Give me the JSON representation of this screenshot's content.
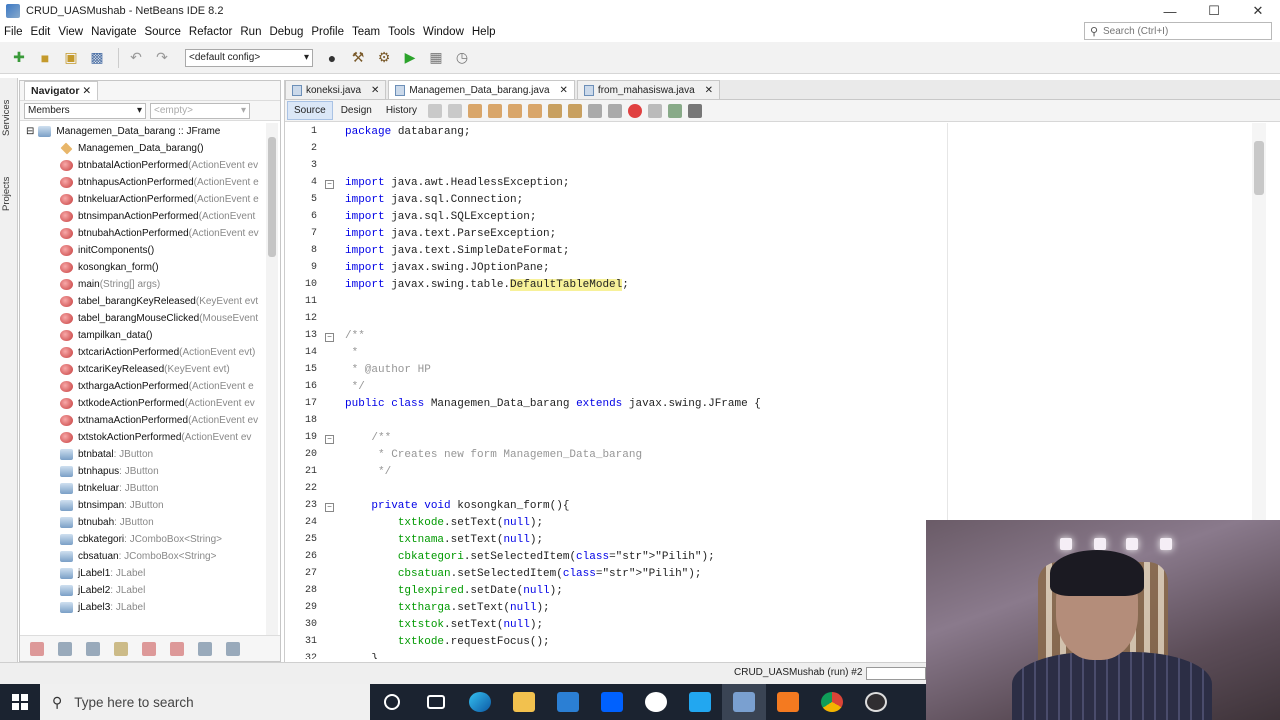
{
  "window": {
    "title": "CRUD_UASMushab - NetBeans IDE 8.2",
    "controls": [
      "—",
      "☐",
      "✕"
    ]
  },
  "menu": [
    "File",
    "Edit",
    "View",
    "Navigate",
    "Source",
    "Refactor",
    "Run",
    "Debug",
    "Profile",
    "Team",
    "Tools",
    "Window",
    "Help"
  ],
  "search": {
    "placeholder": "Search (Ctrl+I)"
  },
  "toolbar": {
    "config": "<default config>"
  },
  "side_tabs": [
    "Services",
    "Projects"
  ],
  "navigator": {
    "title": "Navigator",
    "filter": "Members",
    "empty": "<empty>",
    "root": "Managemen_Data_barang :: JFrame",
    "items": [
      {
        "name": "Managemen_Data_barang()",
        "sig": "",
        "kind": "ctor"
      },
      {
        "name": "btnbatalActionPerformed",
        "sig": "(ActionEvent ev",
        "kind": "m"
      },
      {
        "name": "btnhapusActionPerformed",
        "sig": "(ActionEvent e",
        "kind": "m"
      },
      {
        "name": "btnkeluarActionPerformed",
        "sig": "(ActionEvent e",
        "kind": "m"
      },
      {
        "name": "btnsimpanActionPerformed",
        "sig": "(ActionEvent",
        "kind": "m"
      },
      {
        "name": "btnubahActionPerformed",
        "sig": "(ActionEvent ev",
        "kind": "m"
      },
      {
        "name": "initComponents()",
        "sig": "",
        "kind": "m"
      },
      {
        "name": "kosongkan_form()",
        "sig": "",
        "kind": "m"
      },
      {
        "name": "main",
        "sig": "(String[] args)",
        "kind": "m"
      },
      {
        "name": "tabel_barangKeyReleased",
        "sig": "(KeyEvent evt",
        "kind": "m"
      },
      {
        "name": "tabel_barangMouseClicked",
        "sig": "(MouseEvent",
        "kind": "m"
      },
      {
        "name": "tampilkan_data()",
        "sig": "",
        "kind": "m"
      },
      {
        "name": "txtcariActionPerformed",
        "sig": "(ActionEvent evt)",
        "kind": "m"
      },
      {
        "name": "txtcariKeyReleased",
        "sig": "(KeyEvent evt)",
        "kind": "m"
      },
      {
        "name": "txthargaActionPerformed",
        "sig": "(ActionEvent e",
        "kind": "m"
      },
      {
        "name": "txtkodeActionPerformed",
        "sig": "(ActionEvent ev",
        "kind": "m"
      },
      {
        "name": "txtnamaActionPerformed",
        "sig": "(ActionEvent ev",
        "kind": "m"
      },
      {
        "name": "txtstokActionPerformed",
        "sig": "(ActionEvent ev",
        "kind": "m"
      },
      {
        "name": "btnbatal",
        "sig": " : JButton",
        "kind": "f"
      },
      {
        "name": "btnhapus",
        "sig": " : JButton",
        "kind": "f"
      },
      {
        "name": "btnkeluar",
        "sig": " : JButton",
        "kind": "f"
      },
      {
        "name": "btnsimpan",
        "sig": " : JButton",
        "kind": "f"
      },
      {
        "name": "btnubah",
        "sig": " : JButton",
        "kind": "f"
      },
      {
        "name": "cbkategori",
        "sig": " : JComboBox<String>",
        "kind": "f"
      },
      {
        "name": "cbsatuan",
        "sig": " : JComboBox<String>",
        "kind": "f"
      },
      {
        "name": "jLabel1",
        "sig": " : JLabel",
        "kind": "f"
      },
      {
        "name": "jLabel2",
        "sig": " : JLabel",
        "kind": "f"
      },
      {
        "name": "jLabel3",
        "sig": " : JLabel",
        "kind": "f"
      }
    ]
  },
  "editor": {
    "tabs": [
      {
        "label": "koneksi.java",
        "active": false
      },
      {
        "label": "Managemen_Data_barang.java",
        "active": true
      },
      {
        "label": "from_mahasiswa.java",
        "active": false
      }
    ],
    "views": [
      "Source",
      "Design",
      "History"
    ],
    "lines": [
      {
        "n": "1",
        "t": "package databarang;"
      },
      {
        "n": "2",
        "t": ""
      },
      {
        "n": "3",
        "t": ""
      },
      {
        "n": "4",
        "t": "import java.awt.HeadlessException;"
      },
      {
        "n": "5",
        "t": "import java.sql.Connection;"
      },
      {
        "n": "6",
        "t": "import java.sql.SQLException;"
      },
      {
        "n": "7",
        "t": "import java.text.ParseException;"
      },
      {
        "n": "8",
        "t": "import java.text.SimpleDateFormat;"
      },
      {
        "n": "9",
        "t": "import javax.swing.JOptionPane;"
      },
      {
        "n": "10",
        "t": "import javax.swing.table.DefaultTableModel;"
      },
      {
        "n": "11",
        "t": ""
      },
      {
        "n": "12",
        "t": ""
      },
      {
        "n": "13",
        "t": "/**"
      },
      {
        "n": "14",
        "t": " *"
      },
      {
        "n": "15",
        "t": " * @author HP"
      },
      {
        "n": "16",
        "t": " */"
      },
      {
        "n": "17",
        "t": "public class Managemen_Data_barang extends javax.swing.JFrame {"
      },
      {
        "n": "18",
        "t": ""
      },
      {
        "n": "19",
        "t": "    /**"
      },
      {
        "n": "20",
        "t": "     * Creates new form Managemen_Data_barang"
      },
      {
        "n": "21",
        "t": "     */"
      },
      {
        "n": "22",
        "t": ""
      },
      {
        "n": "23",
        "t": "    private void kosongkan_form(){"
      },
      {
        "n": "24",
        "t": "        txtkode.setText(null);"
      },
      {
        "n": "25",
        "t": "        txtnama.setText(null);"
      },
      {
        "n": "26",
        "t": "        cbkategori.setSelectedItem(\"Pilih\");"
      },
      {
        "n": "27",
        "t": "        cbsatuan.setSelectedItem(\"Pilih\");"
      },
      {
        "n": "28",
        "t": "        tglexpired.setDate(null);"
      },
      {
        "n": "29",
        "t": "        txtharga.setText(null);"
      },
      {
        "n": "30",
        "t": "        txtstok.setText(null);"
      },
      {
        "n": "31",
        "t": "        txtkode.requestFocus();"
      },
      {
        "n": "32",
        "t": "    }"
      }
    ]
  },
  "status": {
    "run": "CRUD_UASMushab (run) #2"
  },
  "taskbar": {
    "search": "Type here to search"
  }
}
